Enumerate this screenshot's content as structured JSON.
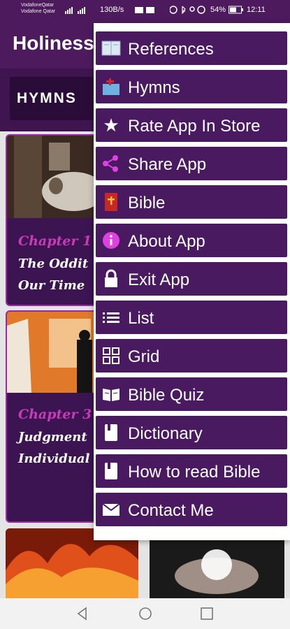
{
  "status_bar": {
    "carrier_1": "VodafoneQatar",
    "carrier_2": "Vodafone Qatar",
    "speed": "130B/s",
    "battery": "54%",
    "time": "12:11"
  },
  "app_bar": {
    "title": "Holiness"
  },
  "tabs": {
    "active": "HYMNS"
  },
  "cards": [
    {
      "chapter": "Chapter 1",
      "title_line1": "The Oddit",
      "title_line2": "Our Time"
    },
    {
      "chapter": "Chapter 3",
      "title_line1": "Judgment",
      "title_line2": "Individual"
    }
  ],
  "menu": {
    "items": [
      {
        "label": "References",
        "icon": "book-icon"
      },
      {
        "label": "Hymns",
        "icon": "hymns-book-icon"
      },
      {
        "label": "Rate App In Store",
        "icon": "star-icon"
      },
      {
        "label": "Share App",
        "icon": "share-icon"
      },
      {
        "label": "Bible",
        "icon": "bible-icon"
      },
      {
        "label": "About App",
        "icon": "info-icon"
      },
      {
        "label": "Exit App",
        "icon": "lock-icon"
      },
      {
        "label": "List",
        "icon": "list-icon"
      },
      {
        "label": "Grid",
        "icon": "grid-icon"
      },
      {
        "label": "Bible Quiz",
        "icon": "open-book-icon"
      },
      {
        "label": "Dictionary",
        "icon": "dictionary-icon"
      },
      {
        "label": "How to read Bible",
        "icon": "bookmark-book-icon"
      },
      {
        "label": "Contact Me",
        "icon": "mail-icon"
      }
    ]
  },
  "colors": {
    "app_bar": "#4d1a5e",
    "menu_item_bg": "#4a1a60",
    "chapter_accent": "#c93bb6",
    "card_border": "#9b2aa0"
  }
}
